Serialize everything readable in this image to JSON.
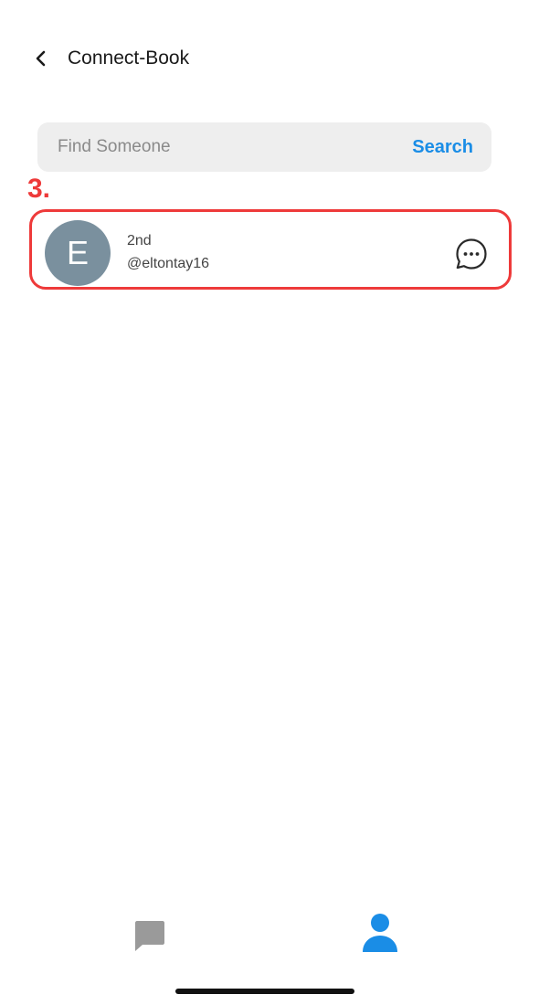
{
  "header": {
    "title": "Connect-Book",
    "back_icon": "chevron-left-icon"
  },
  "search": {
    "placeholder": "Find Someone",
    "value": "",
    "button_label": "Search"
  },
  "annotation": {
    "step_label": "3.",
    "highlight_color": "#ee3a3a"
  },
  "results": [
    {
      "avatar_initial": "E",
      "avatar_color": "#7a909e",
      "degree": "2nd",
      "handle": "@eltontay16",
      "action_icon": "message-icon"
    }
  ],
  "tab_bar": {
    "tabs": [
      {
        "icon": "chat-icon",
        "active": false,
        "color": "#9a9a9a"
      },
      {
        "icon": "profile-icon",
        "active": true,
        "color": "#1a8de6"
      }
    ]
  },
  "colors": {
    "accent": "#1a8de6",
    "search_bg": "#eeeeee"
  }
}
